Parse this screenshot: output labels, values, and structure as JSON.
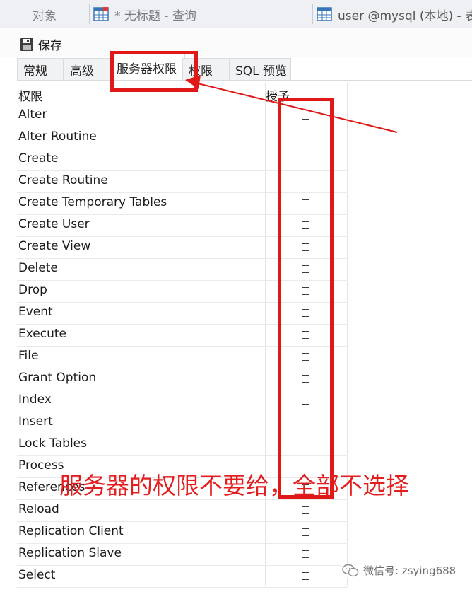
{
  "doc_tabs": [
    {
      "label": "对象"
    },
    {
      "label": "* 无标题 - 查询"
    },
    {
      "label": "user @mysql (本地) - 表"
    }
  ],
  "toolbar": {
    "save_label": "保存"
  },
  "subtabs": [
    {
      "label": "常规"
    },
    {
      "label": "高级"
    },
    {
      "label": "服务器权限",
      "active": true
    },
    {
      "label": "权限"
    },
    {
      "label": "SQL 预览"
    }
  ],
  "grid": {
    "col_privilege": "权限",
    "col_grant": "授予",
    "rows": [
      {
        "name": "Alter",
        "granted": false
      },
      {
        "name": "Alter Routine",
        "granted": false
      },
      {
        "name": "Create",
        "granted": false
      },
      {
        "name": "Create Routine",
        "granted": false
      },
      {
        "name": "Create Temporary Tables",
        "granted": false
      },
      {
        "name": "Create User",
        "granted": false
      },
      {
        "name": "Create View",
        "granted": false
      },
      {
        "name": "Delete",
        "granted": false
      },
      {
        "name": "Drop",
        "granted": false
      },
      {
        "name": "Event",
        "granted": false
      },
      {
        "name": "Execute",
        "granted": false
      },
      {
        "name": "File",
        "granted": false
      },
      {
        "name": "Grant Option",
        "granted": false
      },
      {
        "name": "Index",
        "granted": false
      },
      {
        "name": "Insert",
        "granted": false
      },
      {
        "name": "Lock Tables",
        "granted": false
      },
      {
        "name": "Process",
        "granted": false
      },
      {
        "name": "References",
        "granted": false
      },
      {
        "name": "Reload",
        "granted": false
      },
      {
        "name": "Replication Client",
        "granted": false
      },
      {
        "name": "Replication Slave",
        "granted": false
      },
      {
        "name": "Select",
        "granted": false
      }
    ]
  },
  "annotation": {
    "text": "服务器的权限不要给，全部不选择",
    "color": "#e01818"
  },
  "watermark": {
    "text": "微信号: zsying688"
  }
}
